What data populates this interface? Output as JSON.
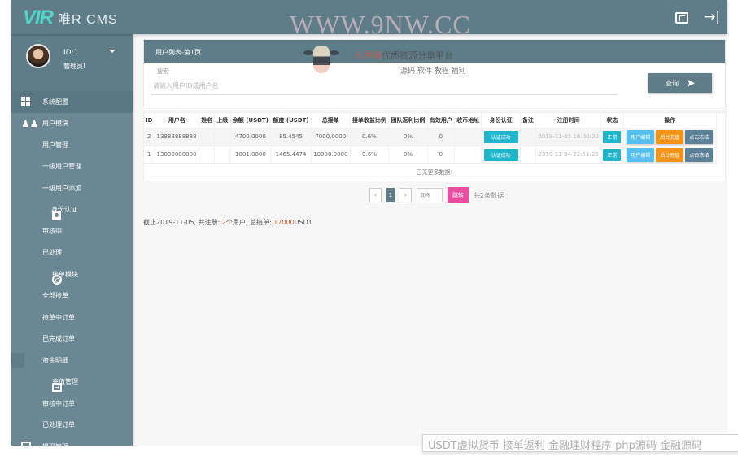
{
  "header": {
    "logo_mark": "VIR",
    "logo_text": "唯R CMS",
    "fullscreen_icon": "fullscreen-icon",
    "exit_icon": "→|"
  },
  "user": {
    "id_label": "ID:1",
    "role": "管理员!"
  },
  "sidebar": {
    "items": [
      {
        "label": "系统配置",
        "type": "parent",
        "icon": "dashboard-grid-icon"
      },
      {
        "label": "用户模块",
        "type": "parent",
        "icon": "users-icon"
      },
      {
        "label": "用户管理",
        "type": "child"
      },
      {
        "label": "一级用户管理",
        "type": "child"
      },
      {
        "label": "一级用户添加",
        "type": "child"
      },
      {
        "label": "身份认证",
        "type": "parent",
        "icon": "id-badge-icon"
      },
      {
        "label": "审核中",
        "type": "child"
      },
      {
        "label": "已处理",
        "type": "child"
      },
      {
        "label": "接单模块",
        "type": "parent",
        "icon": "ring-icon"
      },
      {
        "label": "全部接单",
        "type": "child"
      },
      {
        "label": "接单中订单",
        "type": "child"
      },
      {
        "label": "已完成订单",
        "type": "child"
      },
      {
        "label": "资金明细",
        "type": "child"
      },
      {
        "label": "充值管理",
        "type": "parent",
        "icon": "login-icon"
      },
      {
        "label": "审核中订单",
        "type": "child"
      },
      {
        "label": "已处理订单",
        "type": "child"
      },
      {
        "label": "提现管理",
        "type": "parent",
        "icon": "box-icon"
      }
    ]
  },
  "panel": {
    "title": "用户列表-第1页",
    "search_label": "搜索",
    "search_placeholder": "请输入用户ID或用户名",
    "search_value": "",
    "query_button": "查询",
    "query_arrow": "➤"
  },
  "table": {
    "columns": [
      "ID",
      "用户名",
      "姓名",
      "上级",
      "余额 (USDT)",
      "额度 (USDT)",
      "总接单",
      "接单收益比例",
      "团队返利比例",
      "有效用户",
      "收币地址",
      "身份认证",
      "备注",
      "注册时间",
      "状态",
      "操作"
    ],
    "rows": [
      {
        "id": "2",
        "username": "13888888888",
        "name": "",
        "parent": "",
        "balance": "4700.0000",
        "quota": "85.4545",
        "total_orders": "7000.0000",
        "order_rate": "0.6%",
        "team_rate": "0%",
        "valid_users": "0",
        "address": "",
        "identity": "认证成功",
        "note": "",
        "reg_time": "2019-11-05 16:00:20",
        "status": "正常",
        "ops": [
          "用户编辑",
          "后台充值",
          "点击冻结"
        ]
      },
      {
        "id": "1",
        "username": "13000000000",
        "name": "",
        "parent": "",
        "balance": "1001.0000",
        "quota": "1465.4474",
        "total_orders": "10000.0000",
        "order_rate": "0.6%",
        "team_rate": "0%",
        "valid_users": "0",
        "address": "",
        "identity": "认证成功",
        "note": "",
        "reg_time": "2019-11-04 22:51:25",
        "status": "正常",
        "ops": [
          "用户编辑",
          "后台充值",
          "点击冻结"
        ]
      }
    ],
    "no_more": "已无更多数据!"
  },
  "pagination": {
    "prev": "‹",
    "current": "1",
    "next": "›",
    "input_placeholder": "页码",
    "jump_button": "跳转",
    "total": "共2条数据"
  },
  "summary": {
    "prefix": "截止2019-11-05, 共注册: ",
    "user_count": "2",
    "user_suffix": "个用户, 总接单: ",
    "total_orders": "17000",
    "unit": "USDT"
  },
  "watermarks": {
    "url": "WWW.9NW.CC",
    "brand_red": "九牛网",
    "brand": "优质资源分享平台",
    "sub": "源码 软件 教程 福利",
    "bottom_caption": "USDT虚拟货币 接单返利 金融理财程序  php源码 金融源码"
  },
  "colors": {
    "primary": "#5e7d89",
    "sidebar": "#6a8793",
    "cyan": "#1fb5cc",
    "edit": "#56c0ec",
    "charge": "#f39418",
    "freeze": "#5a8196",
    "jump": "#e94ea0",
    "logo": "#4fd6c6"
  }
}
